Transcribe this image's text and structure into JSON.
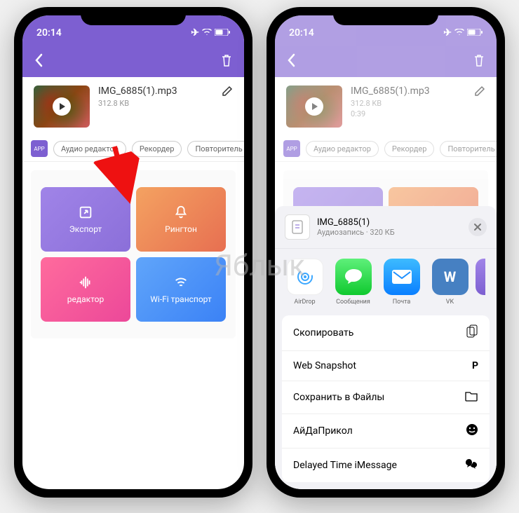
{
  "status": {
    "time": "20:14",
    "airplane_icon": "airplane",
    "wifi_icon": "wifi",
    "battery_icon": "battery"
  },
  "nav": {
    "back_icon": "chevron-left",
    "trash_icon": "trash"
  },
  "file_left": {
    "name": "IMG_6885(1).mp3",
    "size": "312.8 KB"
  },
  "file_right": {
    "name": "IMG_6885(1).mp3",
    "size": "312.8 KB",
    "duration": "0:39"
  },
  "chips": {
    "audio_editor": "Аудио редактор",
    "recorder": "Рекордер",
    "repeater": "Повторитель"
  },
  "tiles": {
    "export": "Экспорт",
    "ringtone": "Рингтон",
    "editor": "редактор",
    "wifi": "Wi-Fi транспорт"
  },
  "share": {
    "title": "IMG_6885(1)",
    "subtitle": "Аудиозапись · 320 КБ",
    "apps": {
      "airdrop": "AirDrop",
      "messages": "Сообщения",
      "mail": "Почта",
      "vk": "VK"
    },
    "actions": {
      "copy": "Скопировать",
      "web_snapshot": "Web Snapshot",
      "save_files": "Сохранить в Файлы",
      "aidaprikol": "АйДаПрикол",
      "delayed": "Delayed Time iMessage"
    }
  },
  "watermark": "Яблык"
}
